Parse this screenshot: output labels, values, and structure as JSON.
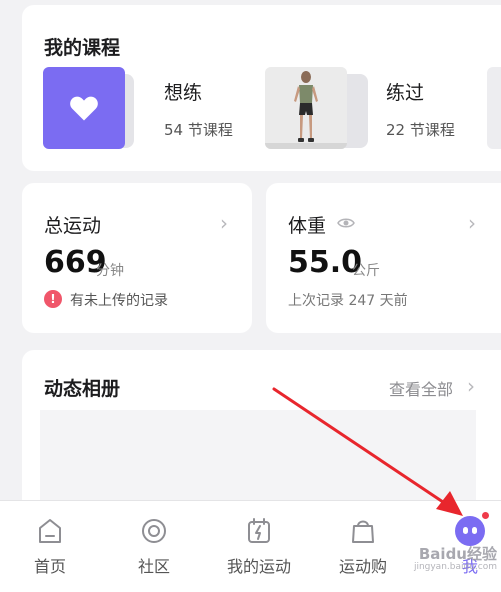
{
  "courses": {
    "title": "我的课程",
    "want": {
      "name": "想练",
      "count": "54 节课程",
      "icon": "heart-icon"
    },
    "done": {
      "name": "练过",
      "count": "22 节课程"
    }
  },
  "sport": {
    "title": "总运动",
    "value": "669",
    "unit": "分钟",
    "warning": "有未上传的记录"
  },
  "weight": {
    "title": "体重",
    "value": "55.0",
    "unit": "公斤",
    "last_record": "上次记录 247 天前"
  },
  "album": {
    "title": "动态相册",
    "view_all": "查看全部"
  },
  "tabbar": {
    "tabs": [
      {
        "label": "首页",
        "icon": "home-icon"
      },
      {
        "label": "社区",
        "icon": "community-icon"
      },
      {
        "label": "我的运动",
        "icon": "my-sport-icon"
      },
      {
        "label": "运动购",
        "icon": "shopping-bag-icon"
      },
      {
        "label": "我",
        "icon": "avatar-icon"
      }
    ]
  },
  "watermark": {
    "brand": "Baidu经验",
    "url": "jingyan.baidu.com"
  },
  "colors": {
    "accent": "#7b6cf2",
    "warning": "#f0566a",
    "badge": "#ef3b4a",
    "arrow": "#e8262d"
  }
}
